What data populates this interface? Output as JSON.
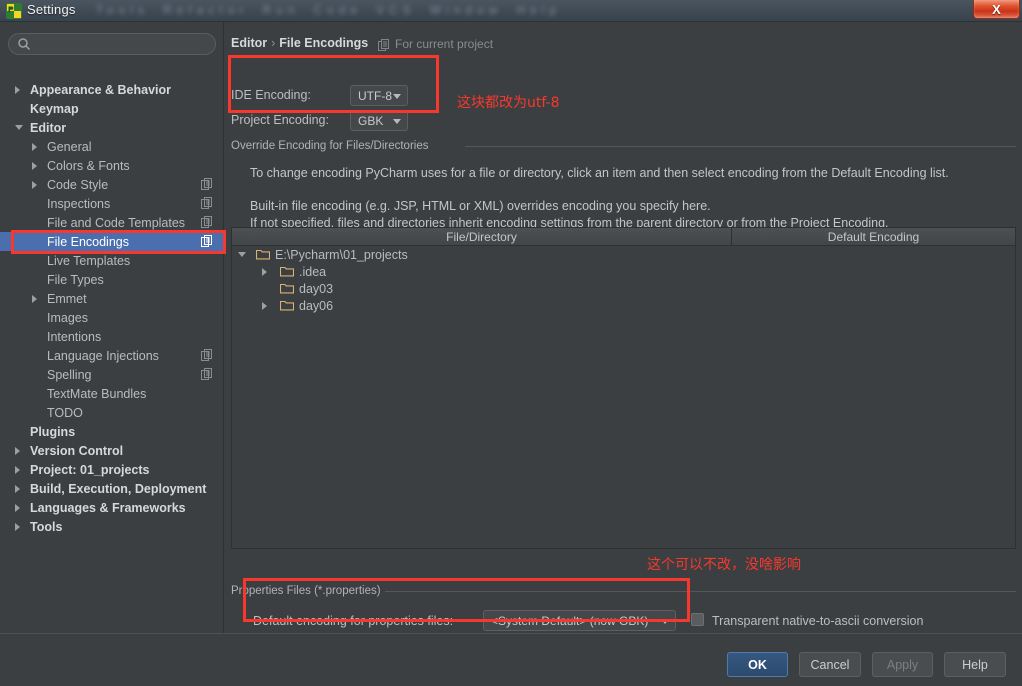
{
  "window": {
    "title": "Settings",
    "close_label": "X",
    "ghost_menu": [
      "Tools",
      "Refactor",
      "Run",
      "Code",
      "VCS",
      "Window",
      "Help"
    ]
  },
  "search": {
    "value": "",
    "placeholder": ""
  },
  "sidebar": {
    "items": [
      {
        "label": "Appearance & Behavior",
        "indent": 30,
        "arrow": "right",
        "bold": true,
        "copy": false,
        "selected": false
      },
      {
        "label": "Keymap",
        "indent": 30,
        "arrow": "none",
        "bold": true,
        "copy": false,
        "selected": false
      },
      {
        "label": "Editor",
        "indent": 30,
        "arrow": "down",
        "bold": true,
        "copy": false,
        "selected": false
      },
      {
        "label": "General",
        "indent": 47,
        "arrow": "right",
        "bold": false,
        "copy": false,
        "selected": false
      },
      {
        "label": "Colors & Fonts",
        "indent": 47,
        "arrow": "right",
        "bold": false,
        "copy": false,
        "selected": false
      },
      {
        "label": "Code Style",
        "indent": 47,
        "arrow": "right",
        "bold": false,
        "copy": true,
        "selected": false
      },
      {
        "label": "Inspections",
        "indent": 47,
        "arrow": "none",
        "bold": false,
        "copy": true,
        "selected": false
      },
      {
        "label": "File and Code Templates",
        "indent": 47,
        "arrow": "none",
        "bold": false,
        "copy": true,
        "selected": false
      },
      {
        "label": "File Encodings",
        "indent": 47,
        "arrow": "none",
        "bold": false,
        "copy": true,
        "selected": true
      },
      {
        "label": "Live Templates",
        "indent": 47,
        "arrow": "none",
        "bold": false,
        "copy": false,
        "selected": false
      },
      {
        "label": "File Types",
        "indent": 47,
        "arrow": "none",
        "bold": false,
        "copy": false,
        "selected": false
      },
      {
        "label": "Emmet",
        "indent": 47,
        "arrow": "right",
        "bold": false,
        "copy": false,
        "selected": false
      },
      {
        "label": "Images",
        "indent": 47,
        "arrow": "none",
        "bold": false,
        "copy": false,
        "selected": false
      },
      {
        "label": "Intentions",
        "indent": 47,
        "arrow": "none",
        "bold": false,
        "copy": false,
        "selected": false
      },
      {
        "label": "Language Injections",
        "indent": 47,
        "arrow": "none",
        "bold": false,
        "copy": true,
        "selected": false
      },
      {
        "label": "Spelling",
        "indent": 47,
        "arrow": "none",
        "bold": false,
        "copy": true,
        "selected": false
      },
      {
        "label": "TextMate Bundles",
        "indent": 47,
        "arrow": "none",
        "bold": false,
        "copy": false,
        "selected": false
      },
      {
        "label": "TODO",
        "indent": 47,
        "arrow": "none",
        "bold": false,
        "copy": false,
        "selected": false
      },
      {
        "label": "Plugins",
        "indent": 30,
        "arrow": "none",
        "bold": true,
        "copy": false,
        "selected": false
      },
      {
        "label": "Version Control",
        "indent": 30,
        "arrow": "right",
        "bold": true,
        "copy": false,
        "selected": false
      },
      {
        "label": "Project: 01_projects",
        "indent": 30,
        "arrow": "right",
        "bold": true,
        "copy": false,
        "selected": false
      },
      {
        "label": "Build, Execution, Deployment",
        "indent": 30,
        "arrow": "right",
        "bold": true,
        "copy": false,
        "selected": false
      },
      {
        "label": "Languages & Frameworks",
        "indent": 30,
        "arrow": "right",
        "bold": true,
        "copy": false,
        "selected": false
      },
      {
        "label": "Tools",
        "indent": 30,
        "arrow": "right",
        "bold": true,
        "copy": false,
        "selected": false
      }
    ]
  },
  "main": {
    "breadcrumb_root": "Editor",
    "breadcrumb_sep": "›",
    "breadcrumb_leaf": "File Encodings",
    "scope_note": "For current project",
    "ide_encoding_label": "IDE Encoding:",
    "ide_encoding_value": "UTF-8",
    "project_encoding_label": "Project Encoding:",
    "project_encoding_value": "GBK",
    "override_group_title": "Override Encoding for Files/Directories",
    "description_lines": [
      "To change encoding PyCharm uses for a file or directory, click an item and then select encoding from the Default Encoding list.",
      "Built-in file encoding (e.g. JSP, HTML or XML) overrides encoding you specify here.",
      "If not specified, files and directories inherit encoding settings from the parent directory or from the Project Encoding."
    ],
    "table": {
      "columns": [
        "File/Directory",
        "Default Encoding"
      ],
      "rows": [
        {
          "name": "E:\\Pycharm\\01_projects",
          "encoding": "",
          "indent": 24,
          "arrow": "down",
          "depth": 0
        },
        {
          "name": ".idea",
          "encoding": "",
          "indent": 48,
          "arrow": "right",
          "depth": 1
        },
        {
          "name": "day03",
          "encoding": "",
          "indent": 48,
          "arrow": "none",
          "depth": 1
        },
        {
          "name": "day06",
          "encoding": "",
          "indent": 48,
          "arrow": "right",
          "depth": 1
        }
      ]
    },
    "properties_group_title": "Properties Files (*.properties)",
    "properties_encoding_label": "Default encoding for properties files:",
    "properties_encoding_value": "<System Default> (now GBK)",
    "transparent_checkbox_label": "Transparent native-to-ascii conversion",
    "transparent_checkbox_checked": false
  },
  "footer": {
    "ok": "OK",
    "cancel": "Cancel",
    "apply": "Apply",
    "help": "Help"
  },
  "annotations": {
    "note_encoding": "这块都改为utf-8",
    "note_properties": "这个可以不改，没啥影响",
    "color": "#f8382c"
  }
}
